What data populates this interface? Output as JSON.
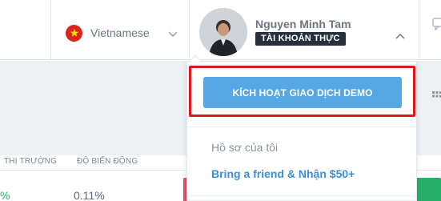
{
  "header": {
    "language": {
      "label": "Vietnamese",
      "flag": "vietnam-flag"
    },
    "profile": {
      "name": "Nguyen Minh Tam",
      "account_type": "TÀI KHOẢN THỰC"
    }
  },
  "dropdown": {
    "demo_button_label": "KÍCH HOẠT GIAO DỊCH DEMO",
    "items": [
      {
        "label": "Hồ sơ của tôi"
      },
      {
        "label": "Bring a friend & Nhận $50+"
      }
    ]
  },
  "table": {
    "columns": [
      "THỊ TRƯỜNG",
      "ĐỘ BIẾN ĐỘNG"
    ],
    "row": {
      "change_left": "%",
      "change_value": "0.11%"
    }
  },
  "colors": {
    "accent_blue": "#55a8e4",
    "highlight_red": "#e0161c",
    "badge_dark": "#26313d",
    "up_green": "#27b06a",
    "down_red": "#e05260"
  }
}
